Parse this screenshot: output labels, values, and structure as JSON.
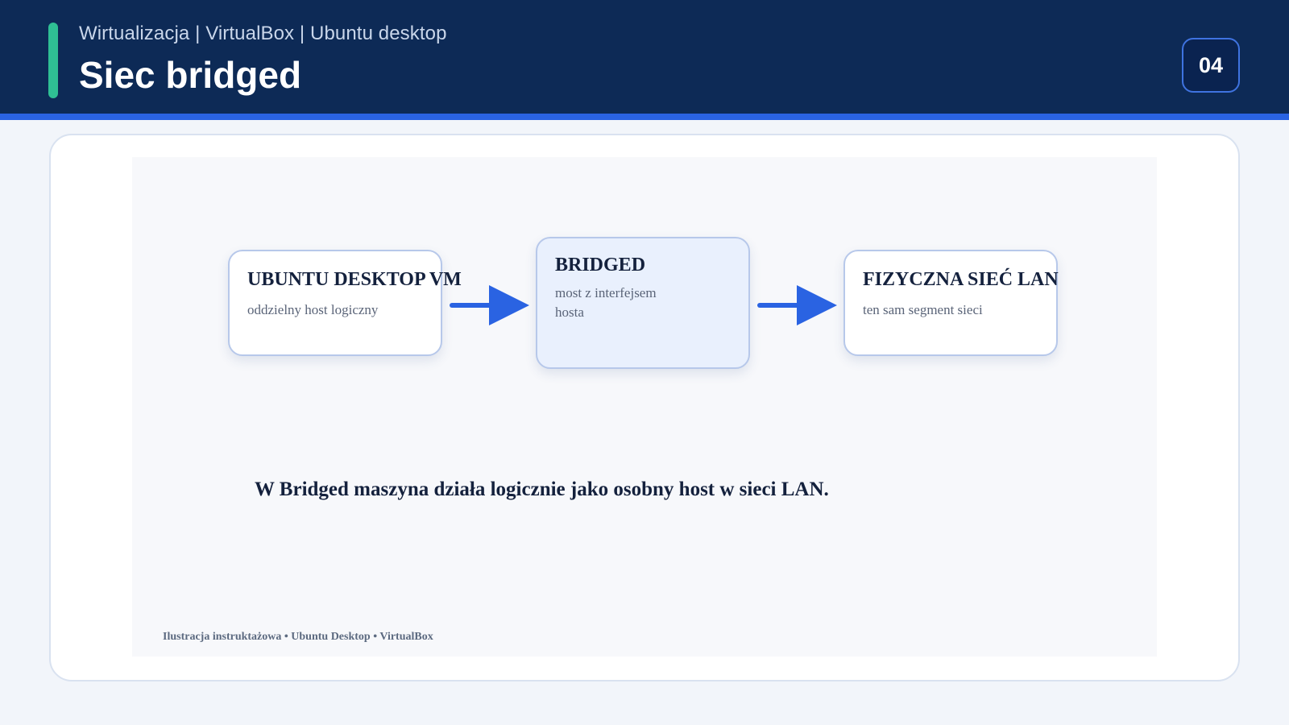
{
  "header": {
    "breadcrumb": "Wirtualizacja | VirtualBox | Ubuntu desktop",
    "title": "Siec bridged",
    "slide_number": "04"
  },
  "diagram": {
    "nodes": [
      {
        "title": "UBUNTU DESKTOP VM",
        "subtitle": "oddzielny host logiczny"
      },
      {
        "title": "BRIDGED",
        "subtitle": "most z interfejsem hosta"
      },
      {
        "title": "FIZYCZNA SIEĆ LAN",
        "subtitle": "ten sam segment sieci"
      }
    ],
    "statement": "W Bridged maszyna działa logicznie jako osobny host w sieci LAN.",
    "caption": "Ilustracja instruktażowa • Ubuntu Desktop • VirtualBox"
  },
  "colors": {
    "header_bg": "#0d2a56",
    "accent_green": "#2fbf94",
    "accent_blue": "#2a63e2",
    "arrow_blue": "#2a63e2"
  },
  "icons": [
    "arrow-right-icon"
  ]
}
